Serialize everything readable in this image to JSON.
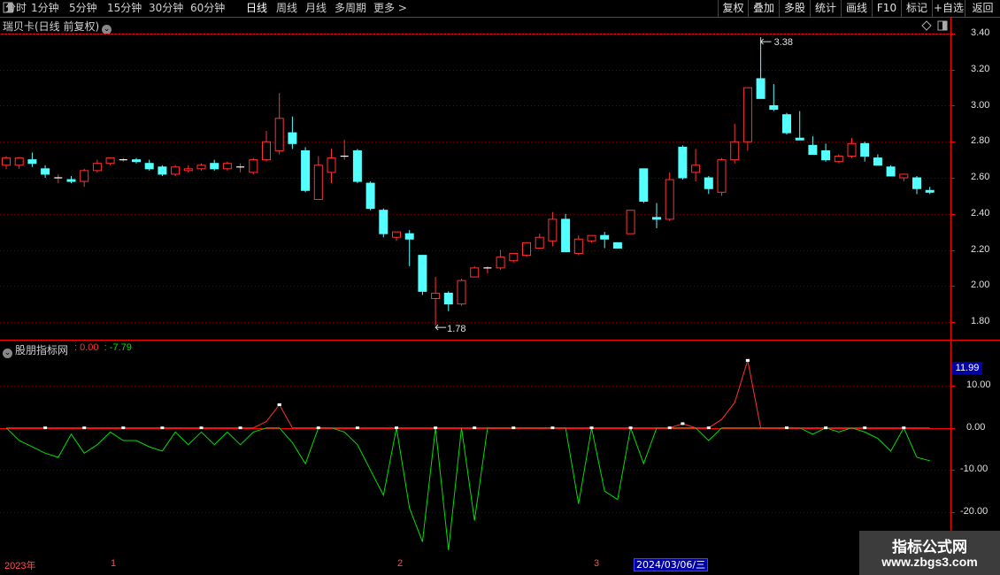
{
  "toolbar": {
    "periods": [
      "分时",
      "1分钟",
      "5分钟",
      "15分钟",
      "30分钟",
      "60分钟",
      "日线",
      "周线",
      "月线",
      "多周期",
      "更多 >"
    ],
    "active_period": "日线",
    "buttons": [
      "复权",
      "叠加",
      "多股",
      "统计",
      "画线",
      "F10",
      "标记",
      "+自选",
      "返回"
    ]
  },
  "main_title": "瑞贝卡(日线 前复权)",
  "price_axis": [
    "3.40",
    "3.20",
    "3.00",
    "2.80",
    "2.60",
    "2.40",
    "2.20",
    "2.00",
    "1.80"
  ],
  "annotations": {
    "high": "3.38",
    "low": "1.78"
  },
  "indicator": {
    "name": "股朋指标网",
    "value1": "0.00",
    "value2": "-7.79",
    "last_value": "11.99",
    "axis": [
      "10.00",
      "0.00",
      "-10.00",
      "-20.00"
    ]
  },
  "time_axis": {
    "labels": [
      "2023年",
      "1",
      "2",
      "3"
    ],
    "cursor_date": "2024/03/06/三"
  },
  "watermark": {
    "line1": "指标公式网",
    "line2": "www.zbgs3.com"
  },
  "colors": {
    "up": "#ff3232",
    "down": "#54ffff",
    "green_line": "#00e000",
    "grid": "#6e0000",
    "accent": "#ff0000"
  },
  "chart_data": {
    "type": "candlestick",
    "ylim": [
      1.72,
      3.44
    ],
    "candles": [
      [
        2.67,
        2.72,
        2.65,
        2.71
      ],
      [
        2.67,
        2.7,
        2.65,
        2.71
      ],
      [
        2.7,
        2.74,
        2.66,
        2.68
      ],
      [
        2.65,
        2.67,
        2.6,
        2.62
      ],
      [
        2.6,
        2.62,
        2.57,
        2.6
      ],
      [
        2.59,
        2.61,
        2.57,
        2.58
      ],
      [
        2.58,
        2.65,
        2.55,
        2.64
      ],
      [
        2.64,
        2.7,
        2.63,
        2.68
      ],
      [
        2.68,
        2.71,
        2.67,
        2.71
      ],
      [
        2.7,
        2.71,
        2.69,
        2.7
      ],
      [
        2.7,
        2.71,
        2.68,
        2.69
      ],
      [
        2.68,
        2.7,
        2.64,
        2.65
      ],
      [
        2.66,
        2.67,
        2.61,
        2.62
      ],
      [
        2.62,
        2.67,
        2.61,
        2.66
      ],
      [
        2.64,
        2.67,
        2.63,
        2.65
      ],
      [
        2.65,
        2.68,
        2.64,
        2.67
      ],
      [
        2.68,
        2.7,
        2.64,
        2.65
      ],
      [
        2.65,
        2.69,
        2.64,
        2.68
      ],
      [
        2.66,
        2.68,
        2.63,
        2.66
      ],
      [
        2.63,
        2.71,
        2.62,
        2.7
      ],
      [
        2.7,
        2.86,
        2.69,
        2.8
      ],
      [
        2.75,
        3.07,
        2.73,
        2.93
      ],
      [
        2.85,
        2.94,
        2.76,
        2.79
      ],
      [
        2.75,
        2.77,
        2.52,
        2.53
      ],
      [
        2.48,
        2.72,
        2.48,
        2.67
      ],
      [
        2.63,
        2.76,
        2.57,
        2.71
      ],
      [
        2.72,
        2.81,
        2.7,
        2.72
      ],
      [
        2.75,
        2.76,
        2.57,
        2.58
      ],
      [
        2.57,
        2.58,
        2.42,
        2.43
      ],
      [
        2.42,
        2.43,
        2.27,
        2.29
      ],
      [
        2.27,
        2.3,
        2.25,
        2.3
      ],
      [
        2.29,
        2.31,
        2.11,
        2.26
      ],
      [
        2.17,
        2.17,
        1.95,
        1.97
      ],
      [
        1.93,
        2.05,
        1.78,
        1.96
      ],
      [
        1.96,
        1.97,
        1.86,
        1.9
      ],
      [
        1.9,
        2.04,
        1.89,
        2.03
      ],
      [
        2.05,
        2.11,
        2.05,
        2.1
      ],
      [
        2.1,
        2.11,
        2.07,
        2.1
      ],
      [
        2.1,
        2.2,
        2.09,
        2.16
      ],
      [
        2.14,
        2.17,
        2.13,
        2.18
      ],
      [
        2.17,
        2.24,
        2.16,
        2.24
      ],
      [
        2.21,
        2.29,
        2.21,
        2.27
      ],
      [
        2.25,
        2.41,
        2.22,
        2.37
      ],
      [
        2.37,
        2.4,
        2.19,
        2.19
      ],
      [
        2.18,
        2.28,
        2.17,
        2.26
      ],
      [
        2.25,
        2.28,
        2.24,
        2.28
      ],
      [
        2.28,
        2.3,
        2.21,
        2.26
      ],
      [
        2.24,
        2.24,
        2.21,
        2.21
      ],
      [
        2.29,
        2.42,
        2.29,
        2.42
      ],
      [
        2.65,
        2.65,
        2.46,
        2.47
      ],
      [
        2.38,
        2.46,
        2.32,
        2.37
      ],
      [
        2.37,
        2.63,
        2.36,
        2.59
      ],
      [
        2.77,
        2.78,
        2.59,
        2.6
      ],
      [
        2.63,
        2.76,
        2.58,
        2.67
      ],
      [
        2.6,
        2.61,
        2.51,
        2.54
      ],
      [
        2.52,
        2.71,
        2.5,
        2.7
      ],
      [
        2.7,
        2.9,
        2.68,
        2.8
      ],
      [
        2.8,
        3.1,
        2.75,
        3.1
      ],
      [
        3.15,
        3.38,
        3.06,
        3.04
      ],
      [
        3.0,
        3.12,
        2.97,
        2.98
      ],
      [
        2.95,
        2.96,
        2.84,
        2.85
      ],
      [
        2.82,
        2.97,
        2.81,
        2.81
      ],
      [
        2.78,
        2.83,
        2.73,
        2.73
      ],
      [
        2.75,
        2.79,
        2.69,
        2.7
      ],
      [
        2.69,
        2.73,
        2.68,
        2.72
      ],
      [
        2.72,
        2.82,
        2.71,
        2.79
      ],
      [
        2.79,
        2.8,
        2.69,
        2.72
      ],
      [
        2.71,
        2.73,
        2.67,
        2.67
      ],
      [
        2.66,
        2.67,
        2.61,
        2.61
      ],
      [
        2.6,
        2.62,
        2.58,
        2.62
      ],
      [
        2.6,
        2.61,
        2.51,
        2.54
      ],
      [
        2.53,
        2.55,
        2.51,
        2.52
      ]
    ],
    "indicator_red": [
      0,
      0,
      0,
      0,
      0,
      0,
      0,
      0,
      0,
      0,
      0,
      0,
      0,
      0,
      0,
      0,
      0,
      0,
      0,
      0,
      1.5,
      5.5,
      0,
      0,
      0,
      0,
      0,
      0,
      0,
      0,
      0,
      0,
      0,
      0,
      0,
      0,
      0,
      0,
      0,
      0,
      0,
      0,
      0,
      0,
      0,
      0,
      0,
      0,
      0,
      0,
      0,
      0,
      1,
      0,
      0,
      2,
      6,
      16,
      0,
      0,
      0,
      0,
      0,
      0,
      0,
      0,
      0,
      0,
      0,
      0,
      0,
      0
    ],
    "indicator_green": [
      0,
      -3,
      -4.5,
      -6,
      -7,
      -1.5,
      -6,
      -4,
      -1,
      -3,
      -3,
      -4.5,
      -5.5,
      -1,
      -4,
      -1,
      -4,
      -1,
      -4,
      -1,
      0,
      0,
      -3.5,
      -8.5,
      0,
      0,
      -1,
      -4,
      -10,
      -16,
      0,
      -19,
      -27,
      0,
      -29,
      0,
      -22,
      0,
      0,
      0,
      0,
      0,
      0,
      0,
      -18,
      0,
      -15,
      -17,
      0,
      -8.5,
      0,
      0,
      0,
      0,
      -3,
      0,
      0,
      0,
      0,
      0,
      0,
      0,
      -1.5,
      0,
      -1,
      0,
      -1,
      -2.5,
      -5.5,
      0,
      -7,
      -7.79
    ]
  }
}
